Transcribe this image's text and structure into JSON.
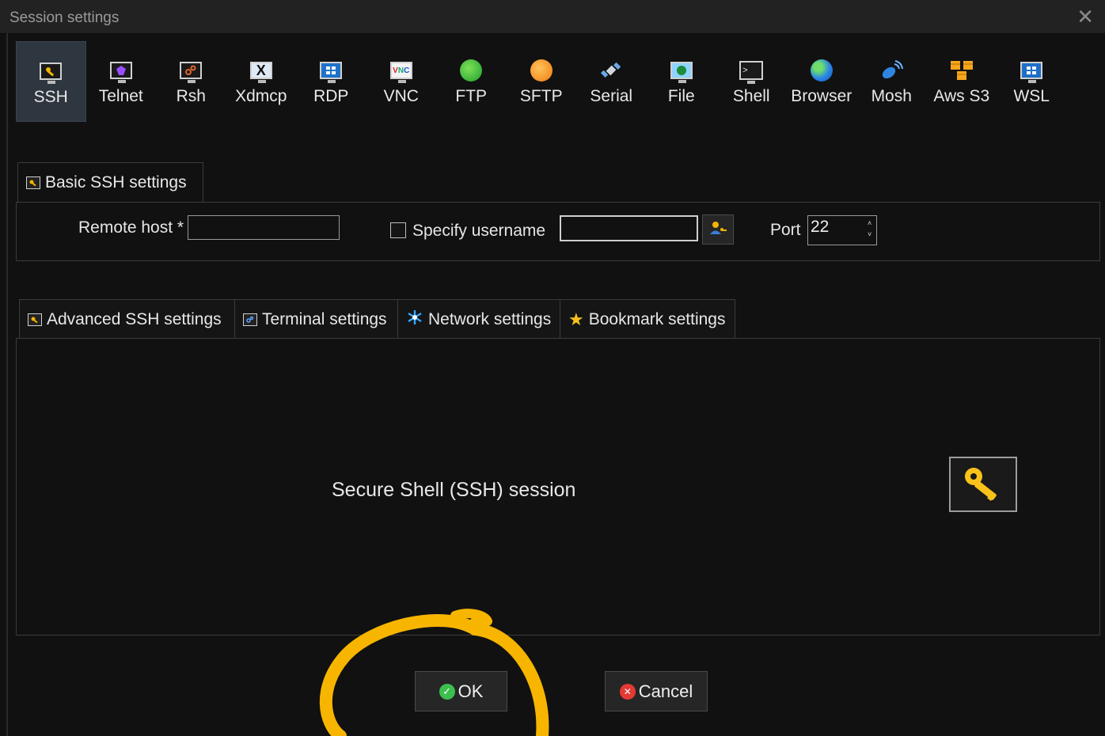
{
  "window": {
    "title": "Session settings"
  },
  "session_types": [
    {
      "label": "SSH",
      "icon": "key-icon",
      "active": true
    },
    {
      "label": "Telnet",
      "icon": "gem-icon"
    },
    {
      "label": "Rsh",
      "icon": "gears-icon"
    },
    {
      "label": "Xdmcp",
      "icon": "x-monitor-icon"
    },
    {
      "label": "RDP",
      "icon": "windows-monitor-icon"
    },
    {
      "label": "VNC",
      "icon": "vnc-monitor-icon"
    },
    {
      "label": "FTP",
      "icon": "green-globe-icon"
    },
    {
      "label": "SFTP",
      "icon": "orange-globe-icon"
    },
    {
      "label": "Serial",
      "icon": "satellite-icon"
    },
    {
      "label": "File",
      "icon": "monitor-globe-icon"
    },
    {
      "label": "Shell",
      "icon": "terminal-icon"
    },
    {
      "label": "Browser",
      "icon": "earth-icon"
    },
    {
      "label": "Mosh",
      "icon": "satellite-dish-icon"
    },
    {
      "label": "Aws S3",
      "icon": "cubes-icon"
    },
    {
      "label": "WSL",
      "icon": "windows-icon"
    }
  ],
  "basic": {
    "tab_label": "Basic SSH settings",
    "remote_host_label": "Remote host",
    "required_marker": "*",
    "remote_host_value": "",
    "specify_username_label": "Specify username",
    "specify_username_checked": false,
    "username_value": "",
    "port_label": "Port",
    "port_value": "22"
  },
  "lower_tabs": [
    {
      "label": "Advanced SSH settings",
      "icon": "key-icon"
    },
    {
      "label": "Terminal settings",
      "icon": "terminal-gear-icon"
    },
    {
      "label": "Network settings",
      "icon": "network-star-icon"
    },
    {
      "label": "Bookmark settings",
      "icon": "star-icon"
    }
  ],
  "description": "Secure Shell (SSH) session",
  "buttons": {
    "ok_label": "OK",
    "cancel_label": "Cancel"
  },
  "colors": {
    "accent_yellow": "#f4b400",
    "annotation": "#f7b500",
    "ok_green": "#3cbf4e",
    "cancel_red": "#e53935"
  }
}
